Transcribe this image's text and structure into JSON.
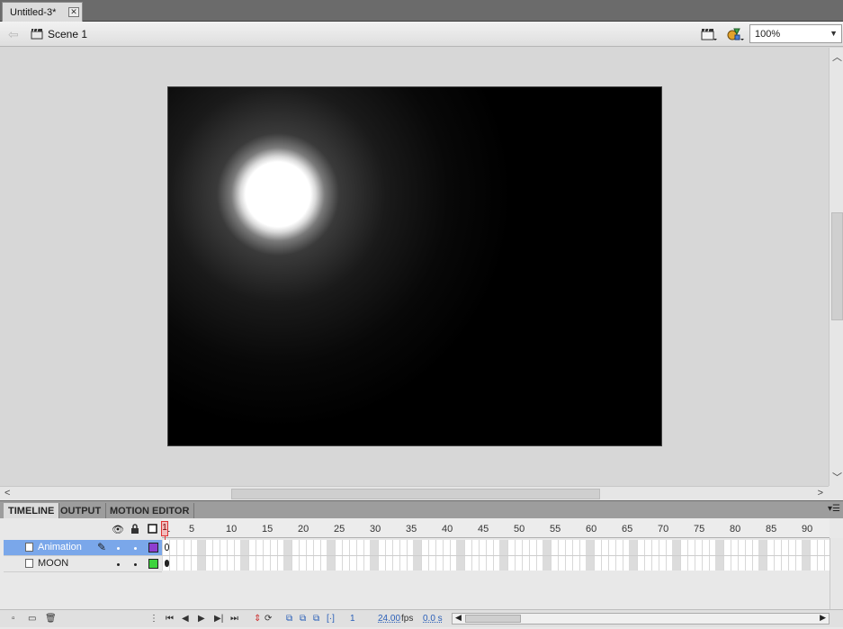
{
  "document": {
    "tab_title": "Untitled-3*",
    "close_glyph": "✕"
  },
  "editbar": {
    "back_icon": "back-arrow-icon",
    "scene_label": "Scene 1",
    "zoom_value": "100%"
  },
  "panel_tabs": [
    "TIMELINE",
    "OUTPUT",
    "MOTION EDITOR"
  ],
  "timeline": {
    "ruler_numbers": [
      "1",
      "5",
      "10",
      "15",
      "20",
      "25",
      "30",
      "35",
      "40",
      "45",
      "50",
      "55",
      "60",
      "65",
      "70",
      "75",
      "80",
      "85",
      "90"
    ],
    "layers": [
      {
        "name": "Animation",
        "selected": true,
        "swatch_color": "#8e3fd0"
      },
      {
        "name": "MOON",
        "selected": false,
        "swatch_color": "#3ed33e"
      }
    ],
    "current_frame": "1",
    "fps_value": "24.00",
    "fps_unit": "fps",
    "time_value": "0.0 s"
  },
  "stage": {
    "background": "#000000",
    "moon_color": "#ffffff"
  }
}
